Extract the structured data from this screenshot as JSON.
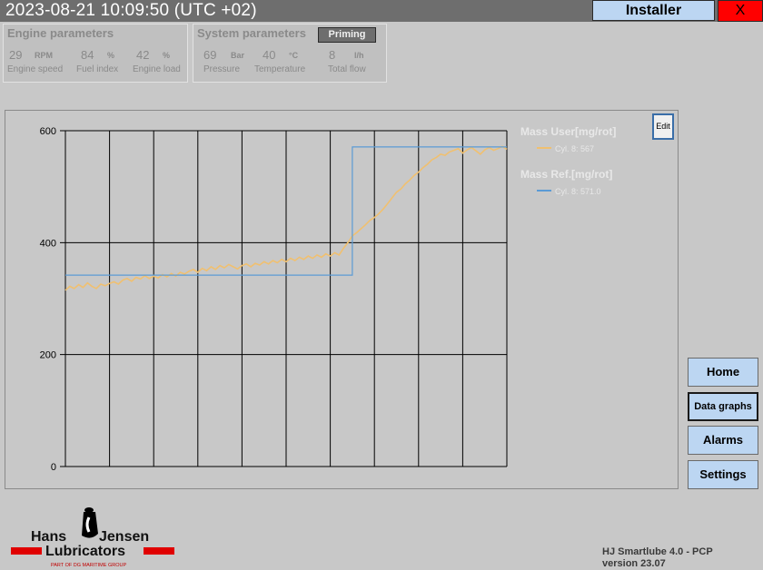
{
  "header": {
    "datetime": "2023-08-21 10:09:50 (UTC +02)",
    "installer_label": "Installer",
    "close_label": "X"
  },
  "engine": {
    "title": "Engine parameters",
    "speed": {
      "value": "29",
      "unit": "RPM",
      "label": "Engine speed"
    },
    "fuel_index": {
      "value": "84",
      "unit": "%",
      "label": "Fuel index"
    },
    "load": {
      "value": "42",
      "unit": "%",
      "label": "Engine load"
    }
  },
  "system": {
    "title": "System parameters",
    "priming_label": "Priming",
    "pressure": {
      "value": "69",
      "unit": "Bar",
      "label": "Pressure"
    },
    "temperature": {
      "value": "40",
      "unit": "°C",
      "label": "Temperature"
    },
    "total_flow": {
      "value": "8",
      "unit": "l/h",
      "label": "Total flow"
    }
  },
  "edit_label": "Edit",
  "nav": {
    "home": "Home",
    "data_graphs": "Data graphs",
    "alarms": "Alarms",
    "settings": "Settings"
  },
  "logo": {
    "line1_left": "Hans",
    "line1_right": "Jensen",
    "line2": "Lubricators",
    "tagline": "PART OF DG MARITIME GROUP"
  },
  "footer": {
    "product": "HJ Smartlube 4.0 - PCP",
    "version": "version 23.07"
  },
  "colors": {
    "accent_button": "#bcd6f2",
    "close_red": "#ff0000",
    "series_user": "#f0c070",
    "series_ref": "#5b9bd5"
  },
  "chart_data": {
    "type": "line",
    "ylim": [
      0,
      600
    ],
    "yticks": [
      "0",
      "200",
      "400",
      "600"
    ],
    "grid": true,
    "legend_position": "right",
    "legend_groups": [
      {
        "title": "Mass User[mg/rot]",
        "entry": "Cyl. 8: 567",
        "color": "#f0c070"
      },
      {
        "title": "Mass Ref.[mg/rot]",
        "entry": "Cyl. 8: 571.0",
        "color": "#5b9bd5"
      }
    ],
    "series": [
      {
        "name": "Cyl. 8: 567",
        "x": [
          0,
          1,
          2,
          3,
          4,
          5,
          6,
          7,
          8,
          9,
          10,
          11,
          12,
          13,
          14,
          15,
          16,
          17,
          18,
          19,
          20,
          21,
          22,
          23,
          24,
          25,
          26,
          27,
          28,
          29,
          30,
          31,
          32,
          33,
          34,
          35,
          36,
          37,
          38,
          39,
          40,
          41,
          42,
          43,
          44,
          45,
          46,
          47,
          48,
          49,
          50,
          51,
          52,
          53,
          54,
          55,
          56,
          57,
          58,
          59,
          60,
          61,
          62,
          63,
          64,
          65,
          66,
          67,
          68,
          69,
          70,
          71,
          72,
          73,
          74,
          75,
          76,
          77,
          78,
          79,
          80,
          81,
          82,
          83,
          84,
          85,
          86,
          87,
          88,
          89,
          90,
          91,
          92,
          93,
          94,
          95,
          96,
          97,
          98,
          99,
          100
        ],
        "values": [
          315,
          322,
          318,
          325,
          320,
          328,
          322,
          318,
          326,
          323,
          327,
          330,
          326,
          333,
          336,
          331,
          338,
          335,
          341,
          336,
          340,
          337,
          343,
          339,
          345,
          340,
          347,
          344,
          349,
          352,
          347,
          354,
          350,
          357,
          352,
          359,
          355,
          361,
          357,
          353,
          359,
          362,
          357,
          363,
          360,
          366,
          362,
          368,
          364,
          370,
          366,
          372,
          368,
          374,
          370,
          376,
          372,
          378,
          374,
          380,
          376,
          382,
          378,
          390,
          400,
          412,
          418,
          425,
          432,
          440,
          445,
          452,
          460,
          470,
          480,
          490,
          496,
          505,
          512,
          520,
          526,
          534,
          540,
          548,
          552,
          558,
          556,
          562,
          565,
          568,
          560,
          566,
          570,
          564,
          558,
          566,
          570,
          565,
          568,
          572,
          567
        ]
      },
      {
        "name": "Cyl. 8: 571.0",
        "x": [
          0,
          65,
          65,
          100
        ],
        "values": [
          342,
          342,
          571,
          571
        ]
      }
    ]
  }
}
